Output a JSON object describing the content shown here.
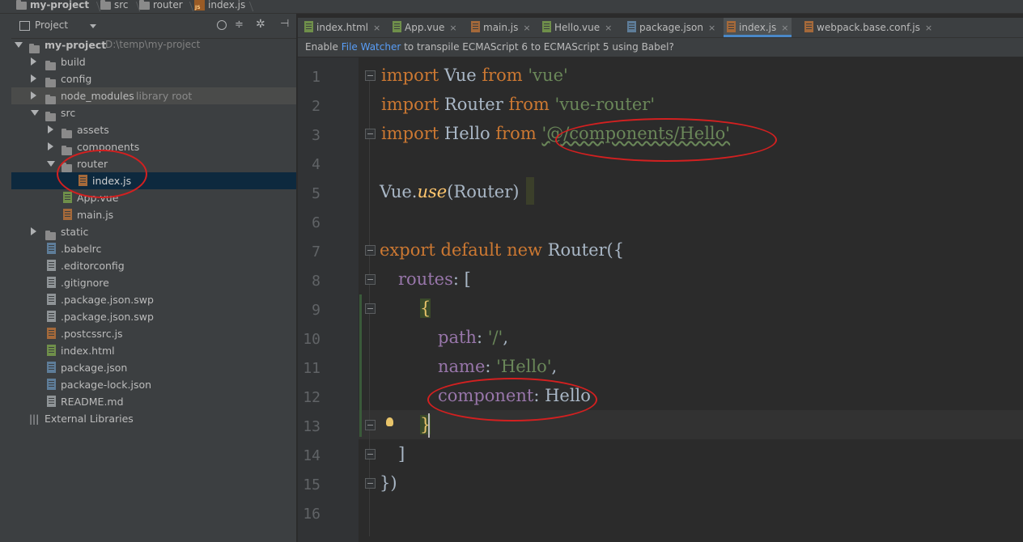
{
  "breadcrumb": {
    "project": "my-project",
    "src": "src",
    "router": "router",
    "file": "index.js"
  },
  "panel": {
    "title": "Project",
    "dropdown_icon": "dropdown-arrow-icon",
    "toolbar_icons": [
      "target-icon",
      "collapse-icon",
      "gear-icon",
      "hide-panel-icon"
    ]
  },
  "tree": {
    "root_label": "my-project",
    "root_path": "D:\\temp\\my-project",
    "build": "build",
    "config": "config",
    "node_modules": "node_modules",
    "library_root": "library root",
    "src": "src",
    "assets": "assets",
    "components": "components",
    "router": "router",
    "index_js": "index.js",
    "app_vue": "App.vue",
    "main_js": "main.js",
    "static": "static",
    "babelrc": ".babelrc",
    "editorconfig": ".editorconfig",
    "gitignore": ".gitignore",
    "pkg_swp1": ".package.json.swp",
    "pkg_swp2": ".package.json.swp",
    "postcssrc": ".postcssrc.js",
    "index_html": "index.html",
    "package_json": "package.json",
    "package_lock": "package-lock.json",
    "readme": "README.md",
    "external": "External Libraries"
  },
  "tabs": [
    {
      "label": "index.html",
      "close": "×"
    },
    {
      "label": "App.vue",
      "close": "×"
    },
    {
      "label": "main.js",
      "close": "×"
    },
    {
      "label": "Hello.vue",
      "close": "×"
    },
    {
      "label": "package.json",
      "close": "×"
    },
    {
      "label": "index.js",
      "close": "×"
    },
    {
      "label": "webpack.base.conf.js",
      "close": "×"
    }
  ],
  "notification": {
    "prefix": "Enable ",
    "link": "File Watcher",
    "suffix": " to transpile ECMAScript 6 to ECMAScript 5 using Babel?"
  },
  "code": {
    "kw_import": "import",
    "kw_from": "from",
    "kw_export": "export",
    "kw_default": "default",
    "kw_new": "new",
    "vue": " Vue ",
    "vue_str": "'vue'",
    "router": " Router ",
    "router_str": "'vue-router'",
    "hello": " Hello ",
    "hello_str": "'@/components/Hello'",
    "vue_dot": "Vue.",
    "use": "use",
    "use_args": "(Router)",
    "router_ctor": " Router({",
    "routes": "routes",
    "routes_open": ": [",
    "brace_open": "{",
    "path": "path",
    "path_val": "'/'",
    "name": "name",
    "name_val": "'Hello'",
    "component": "component",
    "component_val": ": Hello",
    "brace_close": "}",
    "bracket_close": "]",
    "end": "})",
    "colon_sp": ": ",
    "comma": ",",
    "space": " "
  },
  "line_numbers": [
    "1",
    "2",
    "3",
    "4",
    "5",
    "6",
    "7",
    "8",
    "9",
    "10",
    "11",
    "12",
    "13",
    "14",
    "15",
    "16"
  ],
  "colors": {
    "keyword": "#cc7832",
    "string": "#6a8759",
    "property": "#9876aa",
    "function": "#ffc66d",
    "annotation": "#d32020",
    "selection": "#0d293e"
  }
}
